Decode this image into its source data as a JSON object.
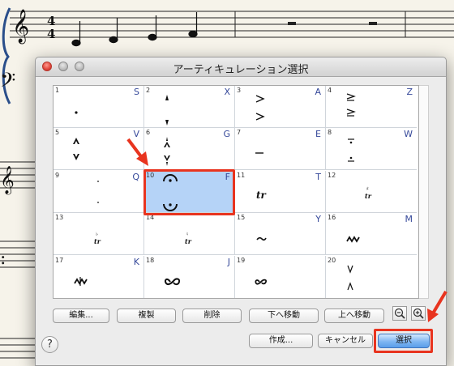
{
  "dialog": {
    "title": "アーティキュレーション選択",
    "buttons": {
      "edit": "編集...",
      "duplicate": "複製",
      "delete": "削除",
      "move_down": "下へ移動",
      "move_up": "上へ移動",
      "create": "作成...",
      "cancel": "キャンセル",
      "select": "選択"
    },
    "help_label": "?",
    "selected_cell": 10
  },
  "articulations": [
    {
      "num": "1",
      "key": "S",
      "symbol": "staccato"
    },
    {
      "num": "2",
      "key": "X",
      "symbol": "staccatissimo"
    },
    {
      "num": "3",
      "key": "A",
      "symbol": "accent"
    },
    {
      "num": "4",
      "key": "Z",
      "symbol": "accent-tenuto"
    },
    {
      "num": "5",
      "key": "V",
      "symbol": "marcato"
    },
    {
      "num": "6",
      "key": "G",
      "symbol": "marcato-staccatissimo"
    },
    {
      "num": "7",
      "key": "E",
      "symbol": "tenuto"
    },
    {
      "num": "8",
      "key": "W",
      "symbol": "tenuto-staccato"
    },
    {
      "num": "9",
      "key": "Q",
      "symbol": "dot-small"
    },
    {
      "num": "10",
      "key": "F",
      "symbol": "fermata"
    },
    {
      "num": "11",
      "key": "T",
      "symbol": "trill"
    },
    {
      "num": "12",
      "key": "",
      "symbol": "trill-sharp"
    },
    {
      "num": "13",
      "key": "",
      "symbol": "trill-flat"
    },
    {
      "num": "14",
      "key": "",
      "symbol": "trill-natural"
    },
    {
      "num": "15",
      "key": "Y",
      "symbol": "turn-short"
    },
    {
      "num": "16",
      "key": "M",
      "symbol": "mordent"
    },
    {
      "num": "17",
      "key": "K",
      "symbol": "inverted-mordent"
    },
    {
      "num": "18",
      "key": "J",
      "symbol": "turn"
    },
    {
      "num": "19",
      "key": "",
      "symbol": "turn-small"
    },
    {
      "num": "20",
      "key": "",
      "symbol": "bow-marks"
    }
  ],
  "colors": {
    "selection": "#b5d3f7",
    "highlight": "#e8341f",
    "key_letter": "#36499a"
  },
  "score": {
    "time_signature_top": "4",
    "time_signature_bottom": "4"
  }
}
